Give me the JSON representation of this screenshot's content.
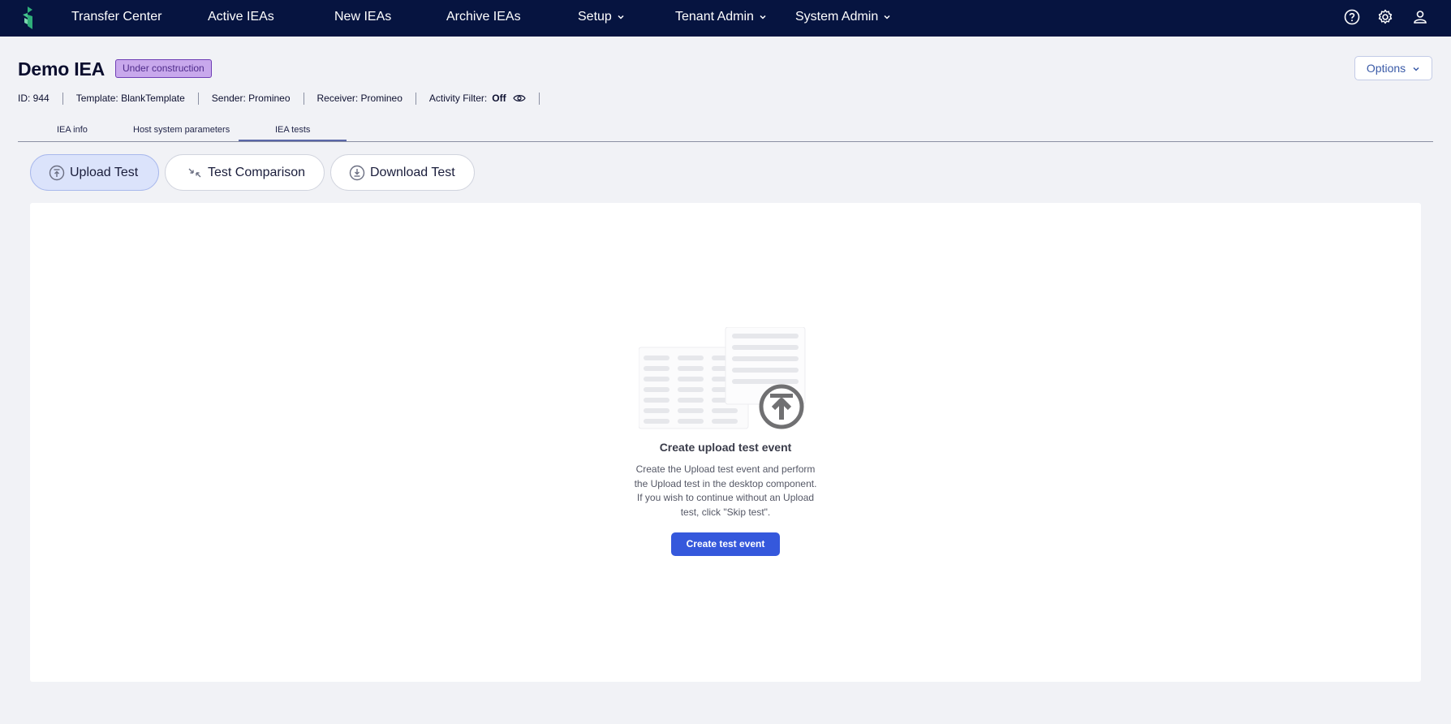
{
  "nav": {
    "items": [
      "Transfer Center",
      "Active IEAs",
      "New IEAs",
      "Archive IEAs",
      "Setup",
      "Tenant Admin",
      "System Admin"
    ],
    "icons": [
      "help-icon",
      "settings-icon",
      "user-icon"
    ]
  },
  "header": {
    "title": "Demo IEA",
    "status": "Under construction",
    "options_label": "Options"
  },
  "meta": {
    "id": "ID: 944",
    "template": "Template: BlankTemplate",
    "sender": "Sender: Promineo",
    "receiver": "Receiver: Promineo",
    "activity_filter_label": "Activity Filter:",
    "activity_filter_value": "Off"
  },
  "tabs": [
    "IEA info",
    "Host system parameters",
    "IEA tests"
  ],
  "active_tab": "IEA tests",
  "test_buttons": [
    "Upload Test",
    "Test Comparison",
    "Download Test"
  ],
  "active_test": "Upload Test",
  "empty_state": {
    "title": "Create upload test event",
    "description": "Create the Upload test event and perform the Upload test in the desktop component. If you wish to continue without an Upload test, click \"Skip test\".",
    "button_label": "Create test event"
  },
  "colors": {
    "nav_bg": "#061440",
    "accent": "#3558dc",
    "badge_bg": "#c8a8ec"
  }
}
